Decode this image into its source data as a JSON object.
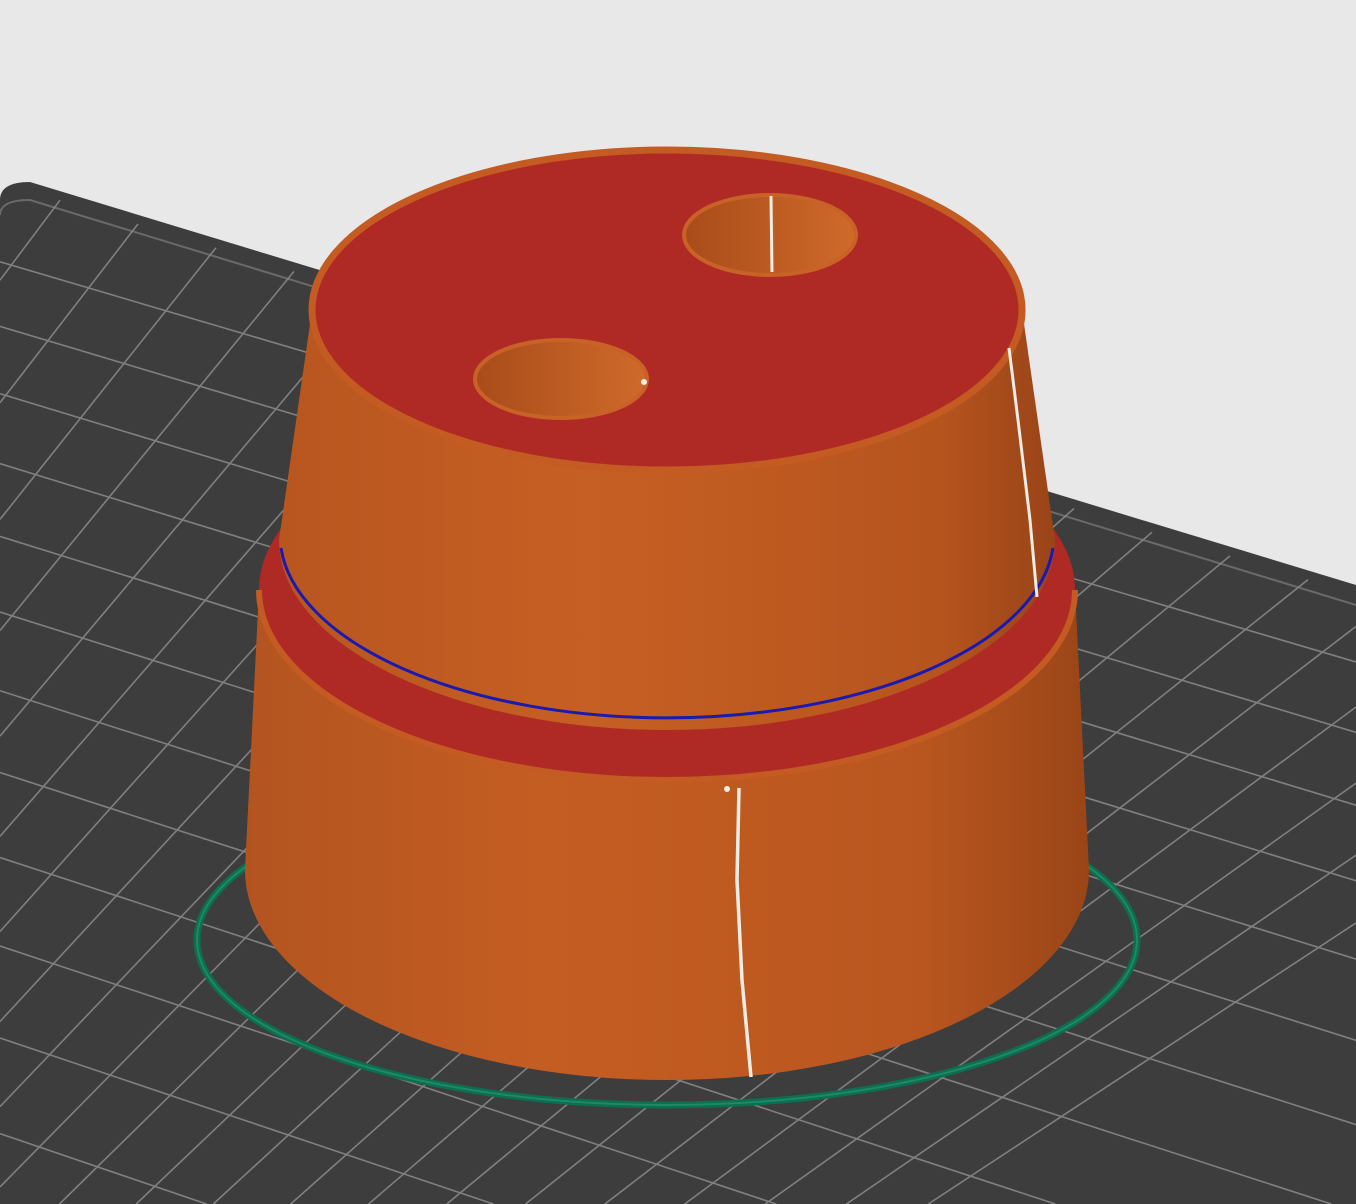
{
  "viewport": {
    "background_color": "#e8e8e8",
    "bed_color": "#3c3d3c",
    "grid_color": "#8a8a8a"
  },
  "model": {
    "wall_color": "#c05a20",
    "top_surface_color": "#b02a25",
    "seam_color": "#f2ede4",
    "skirt_color": "#0d6e50",
    "current_layer_color": "#1a1ab0",
    "hole_count": 2
  }
}
